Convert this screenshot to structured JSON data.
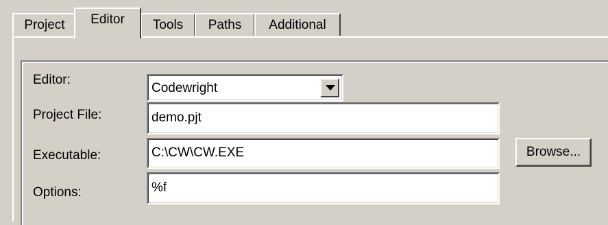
{
  "tabs": [
    {
      "label": "Project"
    },
    {
      "label": "Editor"
    },
    {
      "label": "Tools"
    },
    {
      "label": "Paths"
    },
    {
      "label": "Additional"
    }
  ],
  "active_tab": "Editor",
  "form": {
    "editor_label": "Editor:",
    "editor_value": "Codewright",
    "project_file_label": "Project File:",
    "project_file_value": "demo.pjt",
    "executable_label": "Executable:",
    "executable_value": "C:\\CW\\CW.EXE",
    "browse_label": "Browse...",
    "options_label": "Options:",
    "options_value": "%f"
  },
  "icons": {
    "combo_arrow": "chevron-down-icon"
  }
}
